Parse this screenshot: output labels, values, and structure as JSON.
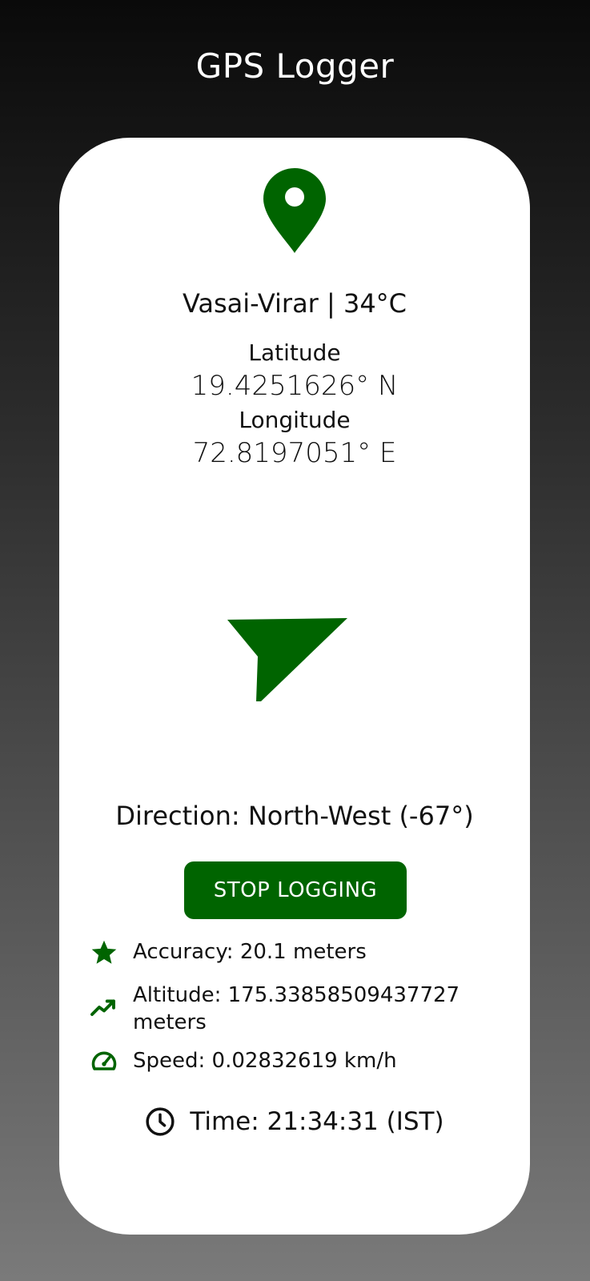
{
  "app": {
    "title": "GPS Logger"
  },
  "location": {
    "place_weather": "Vasai-Virar | 34°C",
    "latitude_label": "Latitude",
    "latitude_value": "19.4251626° N",
    "longitude_label": "Longitude",
    "longitude_value": "72.8197051° E"
  },
  "direction": {
    "text": "Direction: North-West (-67°)"
  },
  "controls": {
    "stop_label": "STOP LOGGING"
  },
  "stats": {
    "accuracy": "Accuracy: 20.1 meters",
    "altitude_line1": "Altitude: 175.33858509437727",
    "altitude_line2": "meters",
    "speed": "Speed: 0.02832619 km/h"
  },
  "time": {
    "text": "Time: 21:34:31 (IST)"
  },
  "icons": {
    "location": "location-pin-icon",
    "direction": "navigation-arrow-icon",
    "accuracy": "star-icon",
    "altitude": "trending-up-icon",
    "speed": "speedometer-icon",
    "time": "clock-icon"
  },
  "colors": {
    "accent": "#006400",
    "card": "#ffffff"
  }
}
